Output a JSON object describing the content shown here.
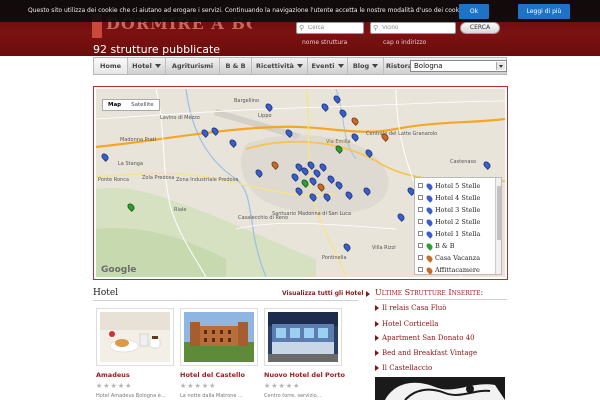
{
  "cookie_bar": {
    "message": "Questo sito utilizza dei cookie che ci aiutano ad erogare i servizi. Continuando la navigazione l'utente accetta le nostre modalità d'uso dei cookie stessi.",
    "ok_label": "Ok",
    "more_label": "Leggi di più"
  },
  "header": {
    "logo_text": "DORMIRE A BOLOGNA",
    "count_text": "92 strutture pubblicate",
    "search_name_placeholder": "Cerca",
    "search_name_label": "nome struttura",
    "search_near_placeholder": "Vicino",
    "search_near_label": "cap o indirizzo",
    "search_button": "CERCA"
  },
  "nav": {
    "items": [
      {
        "label": "Home",
        "dropdown": false
      },
      {
        "label": "Hotel",
        "dropdown": true
      },
      {
        "label": "Agriturismi",
        "dropdown": false
      },
      {
        "label": "B & B",
        "dropdown": false
      },
      {
        "label": "Ricettività",
        "dropdown": true
      },
      {
        "label": "Eventi",
        "dropdown": true
      },
      {
        "label": "Blog",
        "dropdown": true
      },
      {
        "label": "Ristoranti",
        "dropdown": false
      }
    ],
    "city_select": "Bologna"
  },
  "map": {
    "type_buttons": [
      "Map",
      "Satellite"
    ],
    "active_type": "Map",
    "attribution": "Google",
    "zoom_in": "+",
    "zoom_out": "−",
    "legend": [
      {
        "label": "Hotel 5 Stelle",
        "color": "#3a5fcd"
      },
      {
        "label": "Hotel 4 Stelle",
        "color": "#3a5fcd"
      },
      {
        "label": "Hotel 3 Stelle",
        "color": "#3a5fcd"
      },
      {
        "label": "Hotel 2 Stelle",
        "color": "#3a5fcd"
      },
      {
        "label": "Hotel 1 Stella",
        "color": "#3a5fcd"
      },
      {
        "label": "B & B",
        "color": "#2e9e2e"
      },
      {
        "label": "Casa Vacanza",
        "color": "#c86a28"
      },
      {
        "label": "Affittacamere",
        "color": "#c86a28"
      }
    ],
    "place_labels": [
      "Lippo",
      "Bargellino",
      "Lavino di Mezzo",
      "Madonna Prati",
      "La Stanga",
      "Ponte Ronca",
      "Zola Predosa",
      "Riale",
      "Casalecchio di Reno",
      "Zona Industriale Predosa",
      "Santuario Madonna di San Luca",
      "Villa Rizzi",
      "Pontinella",
      "Castenaso",
      "Centrale del Latte Granarolo",
      "Via Emilia"
    ]
  },
  "hotels": {
    "title": "Hotel",
    "view_all": "Visualizza tutti gli Hotel",
    "cards": [
      {
        "name": "Amadeus",
        "stars": "★★★★★",
        "desc": "Hotel Amadeus Bologna è..."
      },
      {
        "name": "Hotel del Castello",
        "stars": "★★★★★",
        "desc": "La notte dalla Matrone ..."
      },
      {
        "name": "Nuovo Hotel del Porto",
        "stars": "★★★★★",
        "desc": "Centro torre, servizio..."
      }
    ]
  },
  "sidebar": {
    "title": "Ultime Strutture Inserite:",
    "items": [
      "Il relais Casa Fluò",
      "Hotel Corticella",
      "Apartment San Donato 40",
      "Bed and Breakfast Vintage",
      "Il Castellaccio"
    ]
  }
}
